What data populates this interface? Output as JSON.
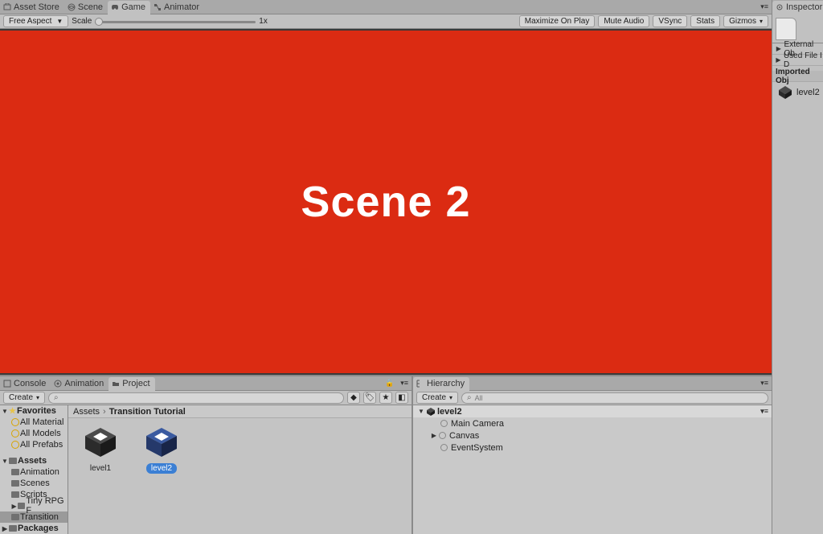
{
  "top_tabs": {
    "asset_store": "Asset Store",
    "scene": "Scene",
    "game": "Game",
    "animator": "Animator"
  },
  "game_toolbar": {
    "aspect": "Free Aspect",
    "scale_label": "Scale",
    "scale_value": "1x",
    "maximize": "Maximize On Play",
    "mute": "Mute Audio",
    "vsync": "VSync",
    "stats": "Stats",
    "gizmos": "Gizmos"
  },
  "scene_text": "Scene 2",
  "project_panel": {
    "tabs": {
      "console": "Console",
      "animation": "Animation",
      "project": "Project"
    },
    "create": "Create",
    "favorites": {
      "header": "Favorites",
      "items": [
        "All Material",
        "All Models",
        "All Prefabs"
      ]
    },
    "assets_tree": {
      "header": "Assets",
      "items": [
        "Animation",
        "Scenes",
        "Scripts",
        "Tiny RPG F",
        "Transition"
      ]
    },
    "packages": "Packages",
    "breadcrumb": {
      "root": "Assets",
      "current": "Transition Tutorial"
    },
    "assets": [
      {
        "name": "level1",
        "selected": false
      },
      {
        "name": "level2",
        "selected": true
      }
    ]
  },
  "hierarchy": {
    "tab": "Hierarchy",
    "create": "Create",
    "search_tag": "All",
    "root": "level2",
    "items": [
      "Main Camera",
      "Canvas",
      "EventSystem"
    ]
  },
  "inspector": {
    "tab": "Inspector",
    "external": "External Ob",
    "used_file": "Used File I D",
    "imported": "Imported Obj",
    "object_name": "level2"
  }
}
